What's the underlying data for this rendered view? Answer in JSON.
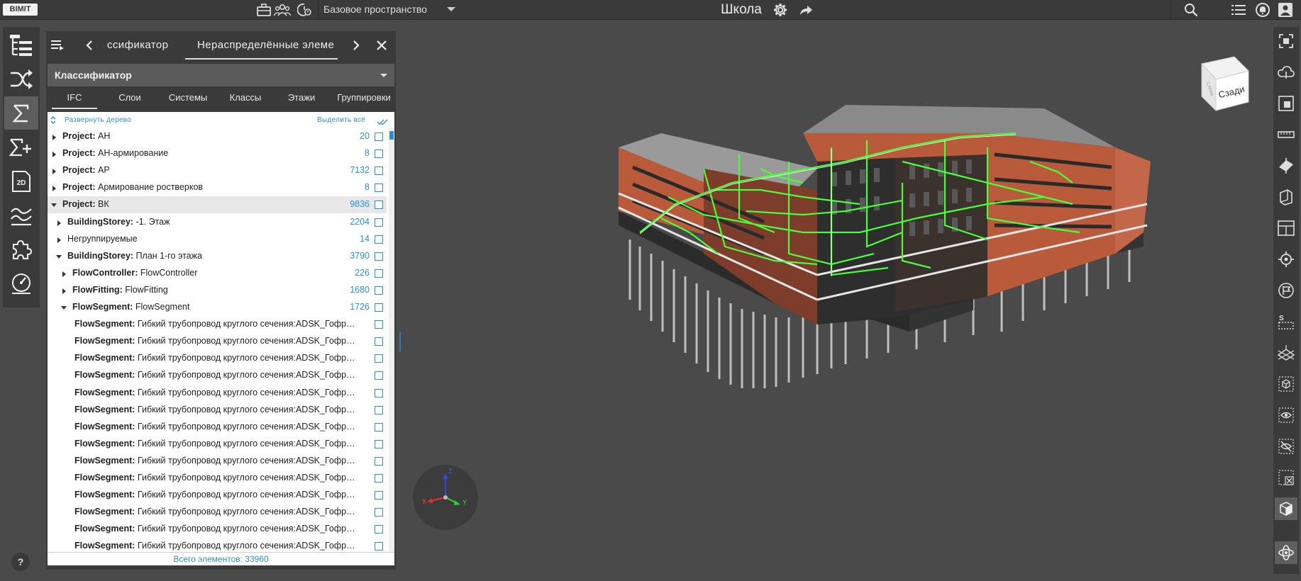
{
  "app": {
    "logo": "BIMIT"
  },
  "header": {
    "workspace": "Базовое пространство",
    "title": "Школа",
    "left_icons": [
      "briefcase-icon",
      "team-icon",
      "clock-settings-icon"
    ],
    "right_icons": [
      "search-icon",
      "list-icon",
      "notifications-icon",
      "user-icon"
    ]
  },
  "left_toolbar": {
    "items": [
      "model-tree-icon",
      "shuffle-icon",
      "sigma-icon",
      "sigma-plus-icon",
      "2d-icon",
      "chart-icon",
      "puzzle-icon",
      "gauge-icon"
    ],
    "active": "sigma-icon",
    "label_2d": "2D",
    "help": "?"
  },
  "panel": {
    "tab_prev": "ссификатор",
    "tab_active": "Нераспределённые элеме",
    "section_title": "Классификатор",
    "subtabs": [
      "IFC",
      "Слои",
      "Системы",
      "Классы",
      "Этажи",
      "Группировки"
    ],
    "active_subtab": "IFC",
    "expand_tree": "Развернуть дерево",
    "select_all": "Выделить всё",
    "total": "Всего элементов: 33960",
    "rows": [
      {
        "key": "Project:",
        "name": " АН",
        "count": "20",
        "indent": 0,
        "state": "collapsed"
      },
      {
        "key": "Project:",
        "name": " АН-армирование",
        "count": "8",
        "indent": 0,
        "state": "collapsed"
      },
      {
        "key": "Project:",
        "name": " АР",
        "count": "7132",
        "indent": 0,
        "state": "collapsed"
      },
      {
        "key": "Project:",
        "name": " Армирование ростверков",
        "count": "8",
        "indent": 0,
        "state": "collapsed"
      },
      {
        "key": "Project:",
        "name": " ВК",
        "count": "9836",
        "indent": 0,
        "state": "expanded",
        "highlight": true
      },
      {
        "key": "BuildingStorey:",
        "name": " -1. Этаж",
        "count": "2204",
        "indent": 1,
        "state": "collapsed"
      },
      {
        "key": "",
        "name": "Негруппируемые",
        "count": "14",
        "indent": 1,
        "state": "collapsed"
      },
      {
        "key": "BuildingStorey:",
        "name": " План 1-го этажа",
        "count": "3790",
        "indent": 1,
        "state": "expanded"
      },
      {
        "key": "FlowController:",
        "name": " FlowController",
        "count": "226",
        "indent": 2,
        "state": "collapsed"
      },
      {
        "key": "FlowFitting:",
        "name": " FlowFitting",
        "count": "1680",
        "indent": 2,
        "state": "collapsed"
      },
      {
        "key": "FlowSegment:",
        "name": " FlowSegment",
        "count": "1726",
        "indent": 2,
        "state": "expanded"
      },
      {
        "key": "FlowSegment:",
        "name": " Гибкий трубопровод круглого сечения:ADSK_Гофра для си...",
        "count": "",
        "indent": 3,
        "state": "leaf"
      },
      {
        "key": "FlowSegment:",
        "name": " Гибкий трубопровод круглого сечения:ADSK_Гофра для си...",
        "count": "",
        "indent": 3,
        "state": "leaf"
      },
      {
        "key": "FlowSegment:",
        "name": " Гибкий трубопровод круглого сечения:ADSK_Гофра для си...",
        "count": "",
        "indent": 3,
        "state": "leaf"
      },
      {
        "key": "FlowSegment:",
        "name": " Гибкий трубопровод круглого сечения:ADSK_Гофра для си...",
        "count": "",
        "indent": 3,
        "state": "leaf"
      },
      {
        "key": "FlowSegment:",
        "name": " Гибкий трубопровод круглого сечения:ADSK_Гофра для си...",
        "count": "",
        "indent": 3,
        "state": "leaf"
      },
      {
        "key": "FlowSegment:",
        "name": " Гибкий трубопровод круглого сечения:ADSK_Гофра для си...",
        "count": "",
        "indent": 3,
        "state": "leaf"
      },
      {
        "key": "FlowSegment:",
        "name": " Гибкий трубопровод круглого сечения:ADSK_Гофра для си...",
        "count": "",
        "indent": 3,
        "state": "leaf"
      },
      {
        "key": "FlowSegment:",
        "name": " Гибкий трубопровод круглого сечения:ADSK_Гофра для си...",
        "count": "",
        "indent": 3,
        "state": "leaf"
      },
      {
        "key": "FlowSegment:",
        "name": " Гибкий трубопровод круглого сечения:ADSK_Гофра для си...",
        "count": "",
        "indent": 3,
        "state": "leaf"
      },
      {
        "key": "FlowSegment:",
        "name": " Гибкий трубопровод круглого сечения:ADSK_Гофра для си...",
        "count": "",
        "indent": 3,
        "state": "leaf"
      },
      {
        "key": "FlowSegment:",
        "name": " Гибкий трубопровод круглого сечения:ADSK_Гофра для си...",
        "count": "",
        "indent": 3,
        "state": "leaf"
      },
      {
        "key": "FlowSegment:",
        "name": " Гибкий трубопровод круглого сечения:ADSK_Гофра для си...",
        "count": "",
        "indent": 3,
        "state": "leaf"
      },
      {
        "key": "FlowSegment:",
        "name": " Гибкий трубопровод круглого сечения:ADSK_Гофра для си...",
        "count": "",
        "indent": 3,
        "state": "leaf"
      },
      {
        "key": "FlowSegment:",
        "name": " Гибкий трубопровод круглого сечения:ADSK_Гофра для си...",
        "count": "",
        "indent": 3,
        "state": "leaf"
      }
    ]
  },
  "viewer": {
    "viewcube_label": "Сзади",
    "viewcube_side": "Слева",
    "axes": {
      "z": "Z",
      "x": "X",
      "y": "Y"
    }
  },
  "right_toolbar": {
    "items": [
      "fit-view-icon",
      "cloud-icon",
      "zoom-box-icon",
      "ruler-icon",
      "section-plane-icon",
      "section-box-icon",
      "layout-icon",
      "target-icon",
      "flag-icon",
      "scale-icon",
      "grid-plane-icon",
      "cube-icon",
      "eye-icon",
      "eye-off-icon",
      "deselect-icon",
      "solid-view-icon",
      "orbit-icon"
    ],
    "active": [
      "solid-view-icon",
      "orbit-icon"
    ],
    "scale_label": "S"
  },
  "colors": {
    "accent": "#2d8fd0",
    "panel": "#3a3a3a",
    "viewport": "#4a4a4a",
    "facade": "#b95a3a",
    "pipes": "#48ff3a"
  }
}
